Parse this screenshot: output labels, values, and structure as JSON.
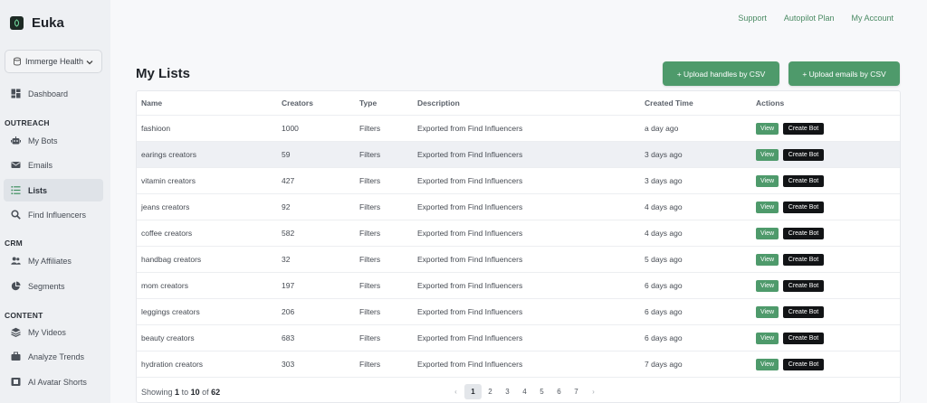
{
  "brand": {
    "name": "Euka"
  },
  "org": {
    "selected": "Immerge Health"
  },
  "sidebar": {
    "items": [
      {
        "label": "Dashboard",
        "icon": "dashboard-icon"
      }
    ],
    "sections": [
      {
        "title": "OUTREACH",
        "items": [
          {
            "label": "My Bots",
            "icon": "robot-icon"
          },
          {
            "label": "Emails",
            "icon": "envelope-icon"
          },
          {
            "label": "Lists",
            "icon": "list-icon",
            "active": true
          },
          {
            "label": "Find Influencers",
            "icon": "search-icon"
          }
        ]
      },
      {
        "title": "CRM",
        "items": [
          {
            "label": "My Affiliates",
            "icon": "users-icon"
          },
          {
            "label": "Segments",
            "icon": "pie-chart-icon"
          }
        ]
      },
      {
        "title": "CONTENT",
        "items": [
          {
            "label": "My Videos",
            "icon": "layers-icon"
          },
          {
            "label": "Analyze Trends",
            "icon": "briefcase-icon"
          },
          {
            "label": "AI Avatar Shorts",
            "icon": "film-icon"
          }
        ]
      }
    ]
  },
  "topnav": {
    "support": "Support",
    "plan": "Autopilot Plan",
    "account": "My Account"
  },
  "page": {
    "title": "My Lists",
    "upload_handles": "+ Upload handles by CSV",
    "upload_emails": "+ Upload emails by CSV"
  },
  "table": {
    "headers": {
      "name": "Name",
      "creators": "Creators",
      "type": "Type",
      "description": "Description",
      "created": "Created Time",
      "actions": "Actions"
    },
    "view_label": "View",
    "bot_label": "Create Bot",
    "rows": [
      {
        "name": "fashioon",
        "creators": "1000",
        "type": "Filters",
        "description": "Exported from Find Influencers",
        "created": "a day ago"
      },
      {
        "name": "earings creators",
        "creators": "59",
        "type": "Filters",
        "description": "Exported from Find Influencers",
        "created": "3 days ago"
      },
      {
        "name": "vitamin creators",
        "creators": "427",
        "type": "Filters",
        "description": "Exported from Find Influencers",
        "created": "3 days ago"
      },
      {
        "name": "jeans creators",
        "creators": "92",
        "type": "Filters",
        "description": "Exported from Find Influencers",
        "created": "4 days ago"
      },
      {
        "name": "coffee creators",
        "creators": "582",
        "type": "Filters",
        "description": "Exported from Find Influencers",
        "created": "4 days ago"
      },
      {
        "name": "handbag creators",
        "creators": "32",
        "type": "Filters",
        "description": "Exported from Find Influencers",
        "created": "5 days ago"
      },
      {
        "name": "mom creators",
        "creators": "197",
        "type": "Filters",
        "description": "Exported from Find Influencers",
        "created": "6 days ago"
      },
      {
        "name": "leggings creators",
        "creators": "206",
        "type": "Filters",
        "description": "Exported from Find Influencers",
        "created": "6 days ago"
      },
      {
        "name": "beauty creators",
        "creators": "683",
        "type": "Filters",
        "description": "Exported from Find Influencers",
        "created": "6 days ago"
      },
      {
        "name": "hydration creators",
        "creators": "303",
        "type": "Filters",
        "description": "Exported from Find Influencers",
        "created": "7 days ago"
      }
    ]
  },
  "pagination": {
    "showing_prefix": "Showing",
    "from": "1",
    "to_word": "to",
    "to": "10",
    "of_word": "of",
    "total": "62",
    "pages": [
      "1",
      "2",
      "3",
      "4",
      "5",
      "6",
      "7"
    ],
    "current": "1",
    "prev_icon": "‹",
    "next_icon": "›"
  },
  "colors": {
    "accent": "#4e9a6b",
    "dark_button": "#121416",
    "sidebar_bg": "#eef0f3"
  }
}
